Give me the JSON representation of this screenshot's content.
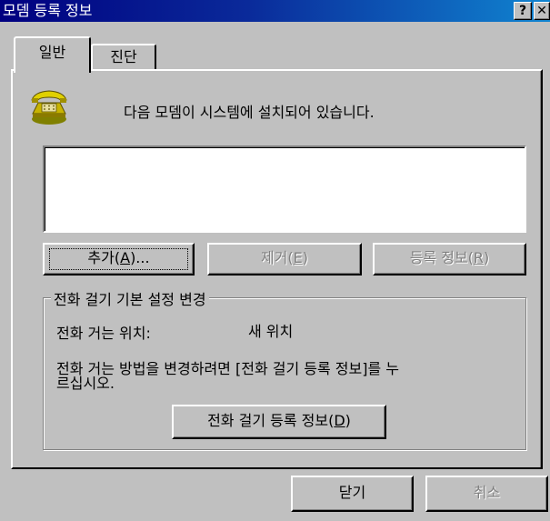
{
  "window": {
    "title": "모뎀 등록 정보",
    "help_button": "?",
    "close_button": "✕"
  },
  "tabs": [
    {
      "label": "일반",
      "selected": true
    },
    {
      "label": "진단",
      "selected": false
    }
  ],
  "general": {
    "intro_text": "다음 모뎀이 시스템에 설치되어 있습니다.",
    "modem_list": [],
    "buttons": {
      "add": {
        "label_prefix": "추가(",
        "mnemonic": "A",
        "label_suffix": ")...",
        "enabled": true
      },
      "remove": {
        "label_prefix": "제거(",
        "mnemonic": "E",
        "label_suffix": ")",
        "enabled": false
      },
      "properties": {
        "label_prefix": "등록 정보(",
        "mnemonic": "R",
        "label_suffix": ")",
        "enabled": false
      }
    },
    "dialing_group": {
      "title": "전화 걸기 기본 설정 변경",
      "location_label": "전화 거는 위치:",
      "location_value": "새 위치",
      "help_line1": "전화 거는 방법을 변경하려면 [전화 걸기 등록 정보]를 누",
      "help_line2": "르십시오.",
      "dialing_properties_button": {
        "label_prefix": "전화 걸기 등록 정보(",
        "mnemonic": "D",
        "label_suffix": ")"
      }
    }
  },
  "footer": {
    "close_label": "닫기",
    "cancel_label": "취소",
    "cancel_enabled": false
  },
  "icons": {
    "phone": "telephone-icon"
  }
}
